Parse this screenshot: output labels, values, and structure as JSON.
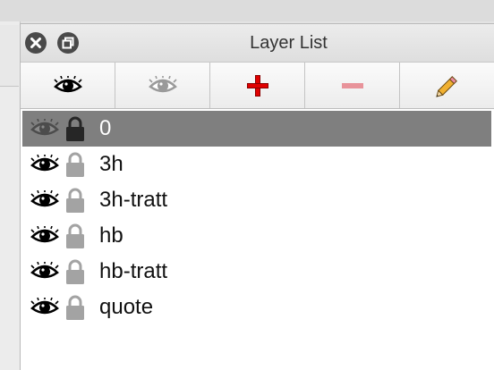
{
  "window": {
    "title": "Layer List"
  },
  "toolbar": {
    "buttons": [
      {
        "name": "show-all-button",
        "icon": "eye-icon"
      },
      {
        "name": "hide-all-button",
        "icon": "eye-gray-icon"
      },
      {
        "name": "add-layer-button",
        "icon": "plus-icon"
      },
      {
        "name": "remove-layer-button",
        "icon": "minus-icon"
      },
      {
        "name": "rename-layer-button",
        "icon": "pencil-icon"
      }
    ]
  },
  "layers": [
    {
      "name": "0",
      "visible": true,
      "locked": true,
      "selected": true
    },
    {
      "name": "3h",
      "visible": true,
      "locked": true,
      "selected": false
    },
    {
      "name": "3h-tratt",
      "visible": true,
      "locked": true,
      "selected": false
    },
    {
      "name": "hb",
      "visible": true,
      "locked": true,
      "selected": false
    },
    {
      "name": "hb-tratt",
      "visible": true,
      "locked": true,
      "selected": false
    },
    {
      "name": "quote",
      "visible": true,
      "locked": true,
      "selected": false
    }
  ],
  "colors": {
    "selected_row": "#7f7f7f",
    "plus": "#e00000",
    "minus": "#e8939a",
    "pencil": "#f0b030"
  }
}
